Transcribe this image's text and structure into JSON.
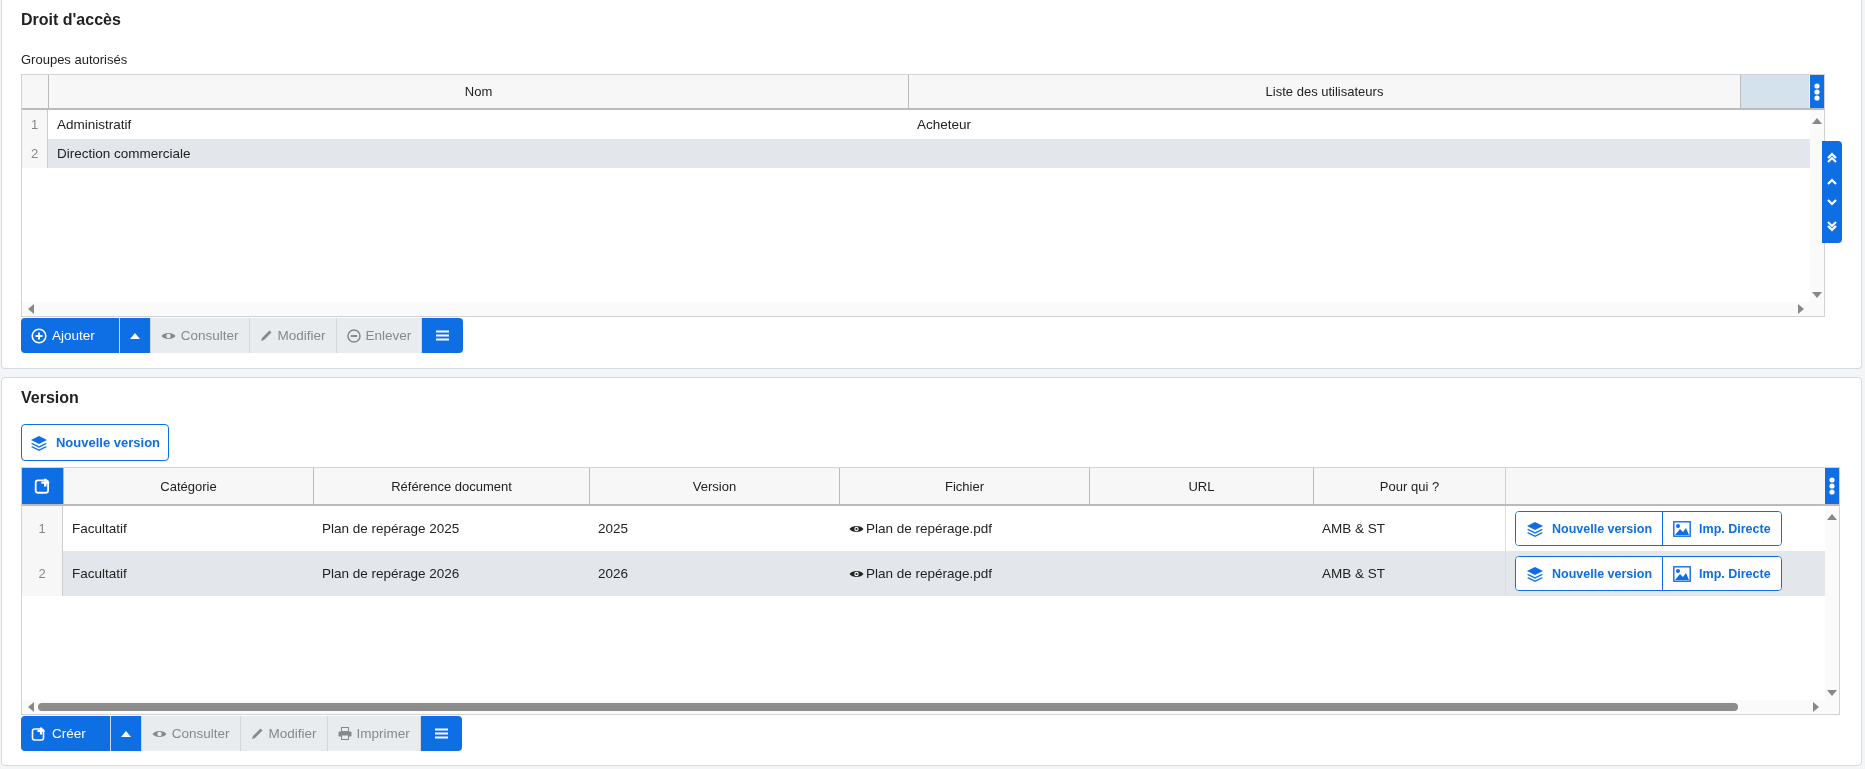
{
  "access": {
    "title": "Droit d'accès",
    "subtitle": "Groupes autorisés",
    "columns": [
      "Nom",
      "Liste des utilisateurs"
    ],
    "rows": [
      {
        "number": "1",
        "cells": [
          "Administratif",
          "Acheteur"
        ],
        "selected": false
      },
      {
        "number": "2",
        "cells": [
          "Direction commerciale"
        ],
        "selected": true
      }
    ],
    "toolbar": [
      {
        "kind": "add",
        "label": "Ajouter"
      },
      {
        "kind": "dropdown"
      },
      {
        "kind": "view",
        "label": "Consulter",
        "disabled": true
      },
      {
        "kind": "edit",
        "label": "Modifier",
        "disabled": true
      },
      {
        "kind": "remove",
        "label": "Enlever",
        "disabled": true
      },
      {
        "kind": "menu"
      }
    ]
  },
  "version": {
    "title": "Version",
    "new_version_button": "Nouvelle version",
    "columns": [
      "Catégorie",
      "Référence document",
      "Version",
      "Fichier",
      "URL",
      "Pour qui ?"
    ],
    "rows": [
      {
        "number": "1",
        "category": "Facultatif",
        "reference": "Plan de repérage 2025",
        "version": "2025",
        "file": "Plan de repérage.pdf",
        "for_whom": "AMB & ST",
        "actions": [
          "Nouvelle version",
          "Imp. Directe"
        ],
        "selected": false
      },
      {
        "number": "2",
        "category": "Facultatif",
        "reference": "Plan de repérage 2026",
        "version": "2026",
        "file": "Plan de repérage.pdf",
        "for_whom": "AMB & ST",
        "actions": [
          "Nouvelle version",
          "Imp. Directe"
        ],
        "selected": true
      }
    ],
    "toolbar": [
      {
        "kind": "create",
        "label": "Créer"
      },
      {
        "kind": "dropdown"
      },
      {
        "kind": "view",
        "label": "Consulter",
        "disabled": true
      },
      {
        "kind": "edit",
        "label": "Modifier",
        "disabled": true
      },
      {
        "kind": "print",
        "label": "Imprimer",
        "disabled": true
      },
      {
        "kind": "menu"
      }
    ]
  }
}
